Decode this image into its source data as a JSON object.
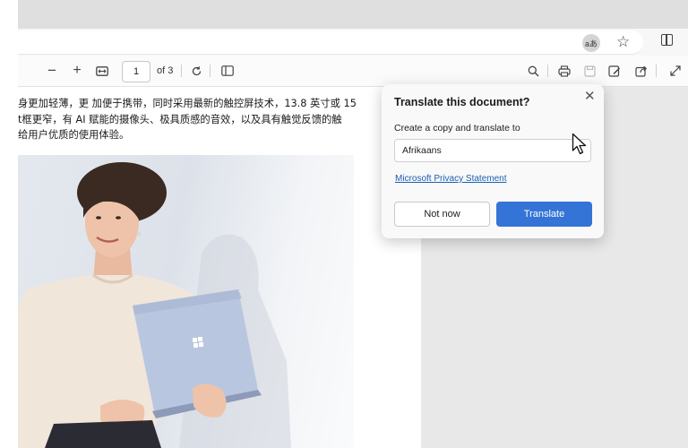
{
  "viewer": {
    "page_current": "1",
    "page_total_label": "of 3"
  },
  "document": {
    "lines": [
      "身更加轻薄，更 加便于携带，同时采用最新的触控屏技术，13.8 英寸或 15",
      "t框更窄，有 AI 赋能的摄像头、极具质感的音效，以及具有触觉反馈的触",
      "给用户优质的使用体验。"
    ]
  },
  "translate_popup": {
    "title": "Translate this document?",
    "label": "Create a copy and translate to",
    "selected_language": "Afrikaans",
    "privacy_link": "Microsoft Privacy Statement",
    "not_now_label": "Not now",
    "translate_label": "Translate",
    "accent_color": "#3474d6"
  },
  "toolbar": {
    "zoom_out": "−",
    "zoom_in": "+"
  },
  "addressbar": {
    "translate_glyph": "aあ"
  }
}
